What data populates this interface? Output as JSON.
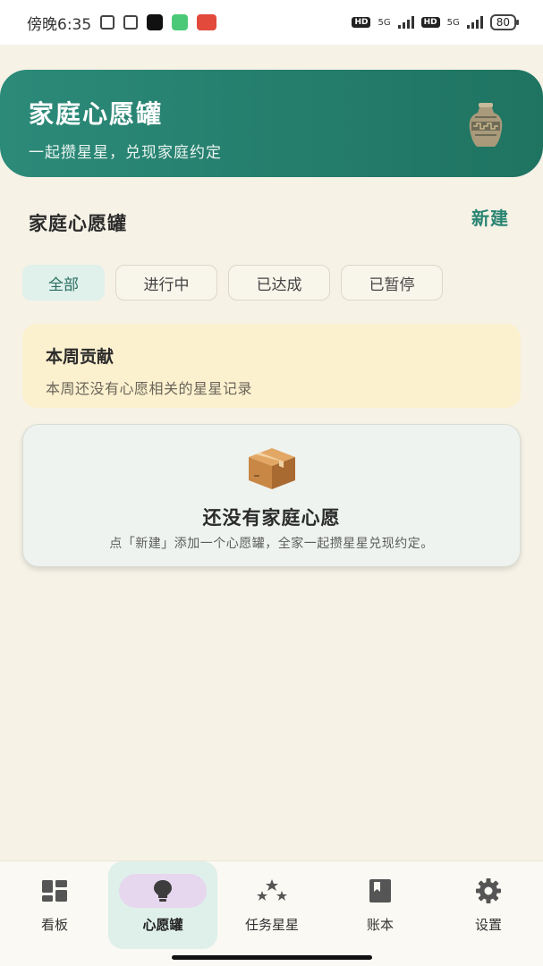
{
  "status_bar": {
    "time": "傍晚6:35",
    "network_1": "5G",
    "network_2": "5G",
    "hd_1": "HD",
    "hd_2": "HD",
    "battery": "80"
  },
  "banner": {
    "title": "家庭心愿罐",
    "subtitle": "一起攒星星，兑现家庭约定",
    "icon": "jar-icon"
  },
  "section": {
    "title": "家庭心愿罐",
    "new_label": "新建"
  },
  "tabs": [
    {
      "label": "全部",
      "active": true
    },
    {
      "label": "进行中",
      "active": false
    },
    {
      "label": "已达成",
      "active": false
    },
    {
      "label": "已暂停",
      "active": false
    }
  ],
  "contribution": {
    "title": "本周贡献",
    "text": "本周还没有心愿相关的星星记录"
  },
  "empty_state": {
    "icon": "box-icon",
    "title": "还没有家庭心愿",
    "text": "点「新建」添加一个心愿罐，全家一起攒星星兑现约定。"
  },
  "bottom_nav": [
    {
      "label": "看板",
      "icon": "dashboard-icon",
      "active": false
    },
    {
      "label": "心愿罐",
      "icon": "lightbulb-icon",
      "active": true
    },
    {
      "label": "任务星星",
      "icon": "stars-icon",
      "active": false
    },
    {
      "label": "账本",
      "icon": "book-icon",
      "active": false
    },
    {
      "label": "设置",
      "icon": "gear-icon",
      "active": false
    }
  ],
  "colors": {
    "primary": "#2a8472",
    "background": "#f6f2e6",
    "contribution_bg": "#fbf1cf",
    "active_tab_bg": "#e0f0ea"
  }
}
